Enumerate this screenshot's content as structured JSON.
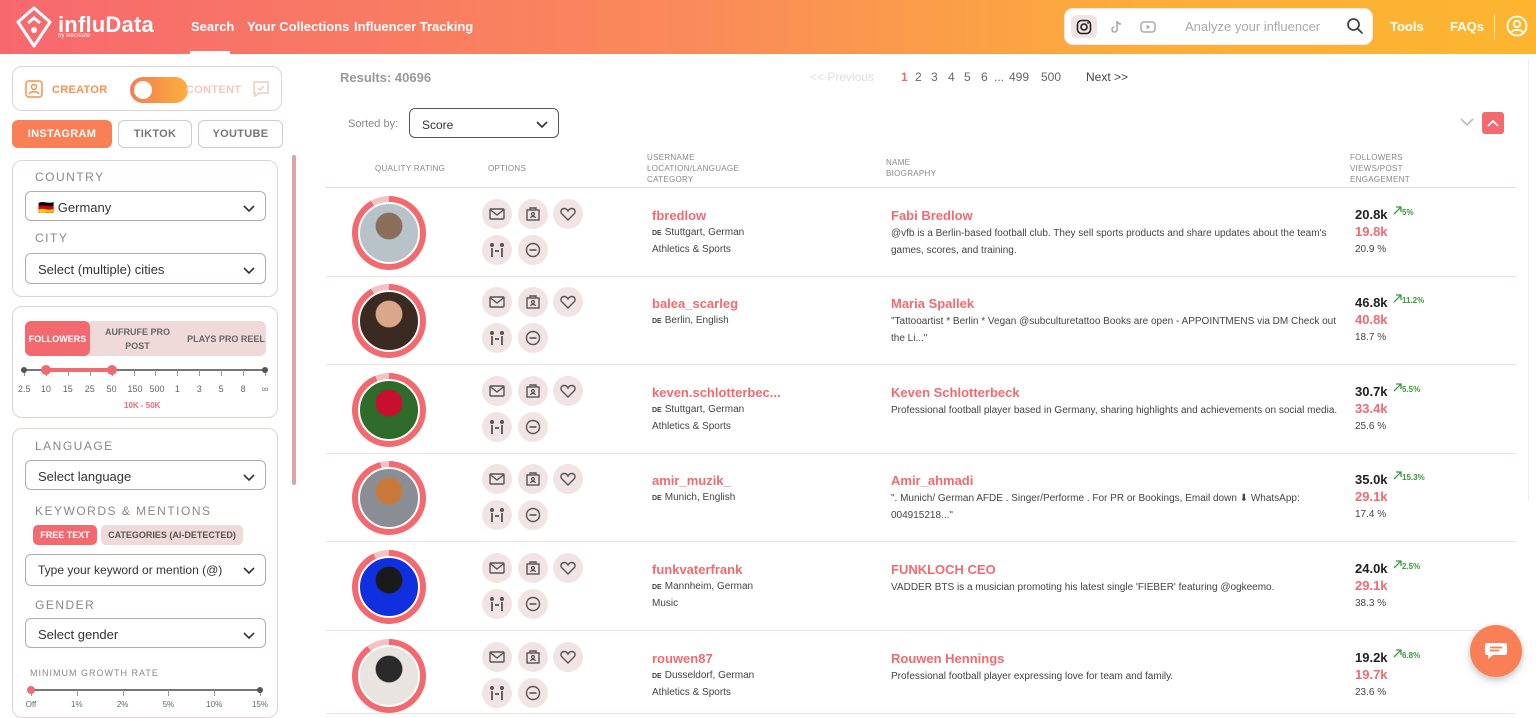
{
  "header": {
    "brand": "influData",
    "brand_sub": "by wecreate",
    "nav": [
      "Search",
      "Your Collections",
      "Influencer Tracking"
    ],
    "search_placeholder": "Analyze your influencer",
    "platforms": [
      "instagram-icon",
      "tiktok-icon",
      "youtube-icon"
    ],
    "tools": "Tools",
    "faqs": "FAQs"
  },
  "sidebar": {
    "creator": "CREATOR",
    "content": "CONTENT",
    "platform_tabs": [
      "INSTAGRAM",
      "TIKTOK",
      "YOUTUBE"
    ],
    "country_label": "COUNTRY",
    "country_value": "🇩🇪 Germany",
    "city_label": "CITY",
    "city_placeholder": "Select (multiple) cities",
    "metric_tabs": [
      "FOLLOWERS",
      "AUFRUFE PRO POST",
      "PLAYS PRO REEL"
    ],
    "slider_ticks": [
      "2.5",
      "10",
      "15",
      "25",
      "50",
      "150",
      "500",
      "1",
      "3",
      "5",
      "8",
      "∞"
    ],
    "slider_range_label": "10K - 50K",
    "slider_range": {
      "min_index": 1,
      "max_index": 4
    },
    "language_label": "LANGUAGE",
    "language_placeholder": "Select language",
    "keywords_label": "KEYWORDS & MENTIONS",
    "keyword_chips": [
      "FREE TEXT",
      "CATEGORIES (AI-DETECTED)"
    ],
    "keyword_placeholder": "Type your keyword or mention (@)",
    "gender_label": "GENDER",
    "gender_placeholder": "Select gender",
    "growth_label": "MINIMUM GROWTH RATE",
    "growth_ticks": [
      "Off",
      "1%",
      "2%",
      "5%",
      "10%",
      "15%"
    ]
  },
  "main": {
    "results": "Results: 40696",
    "pagination": {
      "previous": "<< Previous",
      "pages": [
        "1",
        "2",
        "3",
        "4",
        "5",
        "6",
        "...",
        "499",
        "500"
      ],
      "current": "1",
      "next": "Next >>"
    },
    "sorted_by_label": "Sorted by:",
    "sorted_by_value": "Score",
    "columns": {
      "quality": "QUALITY RATING",
      "options": "OPTIONS",
      "user": [
        "USERNAME",
        "LOCATION/LANGUAGE",
        "CATEGORY"
      ],
      "name": [
        "NAME",
        "BIOGRAPHY"
      ],
      "stats": [
        "FOLLOWERS",
        "VIEWS/POST",
        "ENGAGEMENT"
      ]
    },
    "rows": [
      {
        "username": "fbredlow",
        "cc": "DE",
        "location": "Stuttgart, German",
        "category": "Athletics & Sports",
        "name": "Fabi Bredlow",
        "bio": "@vfb is a Berlin-based football club. They sell sports products and share updates about the team's games, scores, and training.",
        "followers": "20.8k",
        "growth": "5%",
        "views": "19.8k",
        "engagement": "20.9 %",
        "quality": 0.92,
        "av_colors": [
          "#b7c2c9",
          "#8a6d5a"
        ]
      },
      {
        "username": "balea_scarleg",
        "cc": "DE",
        "location": "Berlin, English",
        "category": "",
        "name": "Maria Spallek",
        "bio": "\"Tattooartist * Berlin * Vegan @subculturetattoo Books are open - APPOINTMENS via DM Check out the Li...\"",
        "followers": "46.8k",
        "growth": "11.2%",
        "views": "40.8k",
        "engagement": "18.7 %",
        "quality": 0.92,
        "av_colors": [
          "#3b2a22",
          "#d9a88a"
        ]
      },
      {
        "username": "keven.schlotterbec...",
        "cc": "DE",
        "location": "Stuttgart, German",
        "category": "Athletics & Sports",
        "name": "Keven Schlotterbeck",
        "bio": "Professional football player based in Germany, sharing highlights and achievements on social media.",
        "followers": "30.7k",
        "growth": "5.5%",
        "views": "33.4k",
        "engagement": "25.6 %",
        "quality": 0.94,
        "av_colors": [
          "#2f6b2a",
          "#c8102e"
        ]
      },
      {
        "username": "amir_muzik_",
        "cc": "DE",
        "location": "Munich, English",
        "category": "",
        "name": "Amir_ahmadi",
        "bio": "\". Munich/ German AFDE . Singer/Performe . For PR or Bookings, Email down ⬇ WhatsApp: 004915218...\"",
        "followers": "35.0k",
        "growth": "15.3%",
        "views": "29.1k",
        "engagement": "17.4 %",
        "quality": 0.96,
        "av_colors": [
          "#8a8d93",
          "#c97a3a"
        ]
      },
      {
        "username": "funkvaterfrank",
        "cc": "DE",
        "location": "Mannheim, German",
        "category": "Music",
        "name": "FUNKLOCH CEO",
        "bio": "VADDER BTS is a musician promoting his latest single 'FIEBER' featuring @ogkeemo.",
        "followers": "24.0k",
        "growth": "2.5%",
        "views": "29.1k",
        "engagement": "38.3 %",
        "quality": 0.93,
        "av_colors": [
          "#1030e0",
          "#1a1a1a"
        ]
      },
      {
        "username": "rouwen87",
        "cc": "DE",
        "location": "Dusseldorf, German",
        "category": "Athletics & Sports",
        "name": "Rouwen Hennings",
        "bio": "Professional football player expressing love for team and family.",
        "followers": "19.2k",
        "growth": "6.8%",
        "views": "19.7k",
        "engagement": "23.6 %",
        "quality": 0.9,
        "av_colors": [
          "#e8e4e0",
          "#2a2a2a"
        ]
      }
    ]
  }
}
